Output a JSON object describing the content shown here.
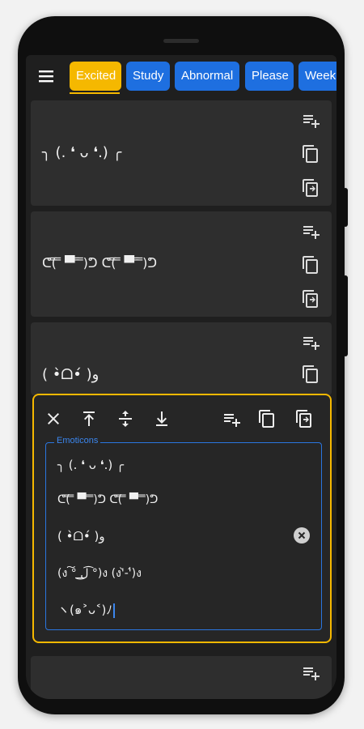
{
  "tabs": [
    {
      "label": "Excited",
      "active": true
    },
    {
      "label": "Study",
      "active": false
    },
    {
      "label": "Abnormal",
      "active": false
    },
    {
      "label": "Please",
      "active": false
    },
    {
      "label": "Week",
      "active": false
    }
  ],
  "cards": [
    {
      "text": "╮ (. ❛ ᴗ ❛.) ╭"
    },
    {
      "text": "ᕦ(̿ ̿ ▀̿ ̿ ̿)ᕤ ᕦ(̿ ̿ ▀̿ ̿ ̿)ᕤ"
    },
    {
      "text": "( •̀ᗝ•́ )و"
    }
  ],
  "editor": {
    "field_label": "Emoticons",
    "lines": [
      "╮ (. ❛ ᴗ ❛.) ╭",
      "ᕦ(̿ ̿ ▀̿ ̿ ̿)ᕤ ᕦ(̿ ̿ ▀̿ ̿ ̿)ᕤ",
      "( •̀ᗝ•́ )و",
      "(ง ͠° ͟ل͜ ͡°)ง (ง'̀-'́)ง",
      "ヽ(๑˃ᴗ˂)ﾉ"
    ]
  },
  "colors": {
    "accent": "#f5b800",
    "tab_blue": "#1e6fe0",
    "field_blue": "#2a76e0",
    "card_bg": "#2e2e2e",
    "screen_bg": "#1f1f1f"
  }
}
